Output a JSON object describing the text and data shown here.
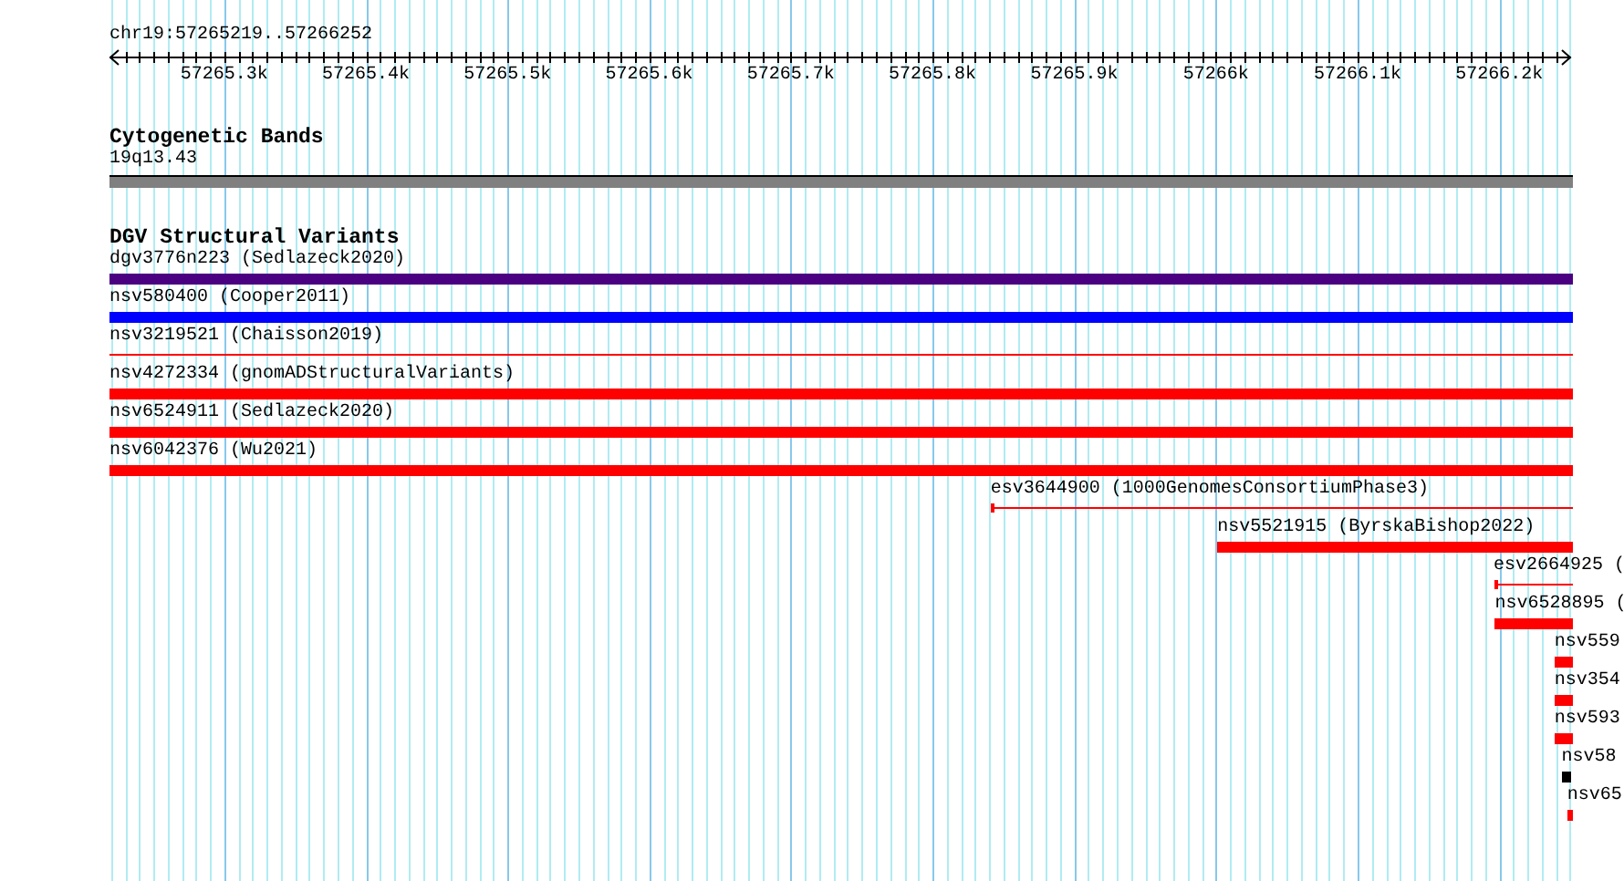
{
  "ruler": {
    "location": "chr19:57265219..57266252",
    "ticks": [
      {
        "label": "57265.3k"
      },
      {
        "label": "57265.4k"
      },
      {
        "label": "57265.5k"
      },
      {
        "label": "57265.6k"
      },
      {
        "label": "57265.7k"
      },
      {
        "label": "57265.8k"
      },
      {
        "label": "57265.9k"
      },
      {
        "label": "57266k"
      },
      {
        "label": "57266.1k"
      },
      {
        "label": "57266.2k"
      }
    ]
  },
  "tracks": [
    {
      "kind": "cytoband",
      "title": "Cytogenetic Bands",
      "band": "19q13.43"
    },
    {
      "kind": "features",
      "title": "DGV Structural Variants",
      "features": [
        {
          "label": "dgv3776n223 (Sedlazeck2020)",
          "kind": "bar",
          "color": "#4b0082"
        },
        {
          "label": "nsv580400 (Cooper2011)",
          "kind": "bar",
          "color": "#0000ff"
        },
        {
          "label": "nsv3219521 (Chaisson2019)",
          "kind": "line",
          "color": "#ff0000"
        },
        {
          "label": "nsv4272334 (gnomADStructuralVariants)",
          "kind": "bar",
          "color": "#ff0000"
        },
        {
          "label": "nsv6524911 (Sedlazeck2020)",
          "kind": "bar",
          "color": "#ff0000"
        },
        {
          "label": "nsv6042376 (Wu2021)",
          "kind": "bar",
          "color": "#ff0000"
        },
        {
          "label": "esv3644900 (1000GenomesConsortiumPhase3)",
          "kind": "line",
          "color": "#ff0000"
        },
        {
          "label": "nsv5521915 (ByrskaBishop2022)",
          "kind": "bar",
          "color": "#ff0000"
        },
        {
          "label": "esv2664925 (",
          "kind": "line",
          "color": "#ff0000"
        },
        {
          "label": "nsv6528895 (",
          "kind": "bar",
          "color": "#ff0000"
        },
        {
          "label": "nsv559",
          "kind": "bar",
          "color": "#ff0000"
        },
        {
          "label": "nsv354",
          "kind": "bar",
          "color": "#ff0000"
        },
        {
          "label": "nsv593",
          "kind": "bar",
          "color": "#ff0000"
        },
        {
          "label": "nsv58",
          "kind": "bar",
          "color": "#000000"
        },
        {
          "label": "nsv65",
          "kind": "bar",
          "color": "#ff0000"
        }
      ]
    }
  ]
}
